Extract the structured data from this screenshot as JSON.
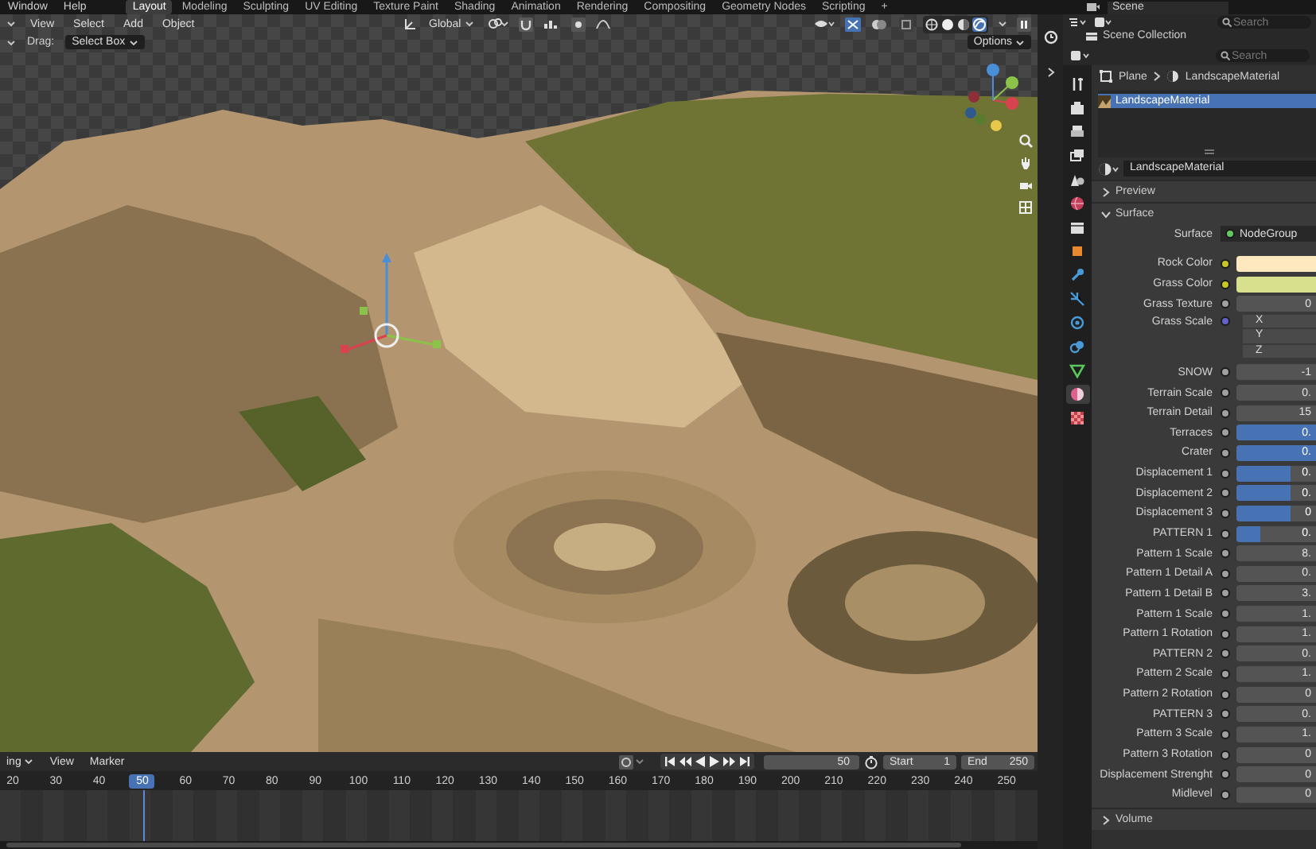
{
  "topbar": {
    "menus": [
      "Window",
      "Help"
    ],
    "workspaces": [
      {
        "label": "Layout",
        "selected": true
      },
      {
        "label": "Modeling",
        "selected": false
      },
      {
        "label": "Sculpting",
        "selected": false
      },
      {
        "label": "UV Editing",
        "selected": false
      },
      {
        "label": "Texture Paint",
        "selected": false
      },
      {
        "label": "Shading",
        "selected": false
      },
      {
        "label": "Animation",
        "selected": false
      },
      {
        "label": "Rendering",
        "selected": false
      },
      {
        "label": "Compositing",
        "selected": false
      },
      {
        "label": "Geometry Nodes",
        "selected": false
      },
      {
        "label": "Scripting",
        "selected": false
      }
    ],
    "add": "+",
    "scene": "Scene"
  },
  "viewport": {
    "menus": [
      "View",
      "Select",
      "Add",
      "Object"
    ],
    "orientation": "Global",
    "drag_label": "Drag:",
    "drag_tool": "Select Box",
    "options": "Options",
    "shading_modes": [
      {
        "kind": "wire",
        "selected": false
      },
      {
        "kind": "solid",
        "selected": false
      },
      {
        "kind": "material",
        "selected": false
      },
      {
        "kind": "rendered",
        "selected": true
      }
    ]
  },
  "outliner": {
    "search_placeholder": "Search",
    "root": "Scene Collection"
  },
  "properties": {
    "search_placeholder": "Search",
    "tabs": [
      {
        "kind": "tool",
        "selected": false
      },
      {
        "kind": "render",
        "selected": false
      },
      {
        "kind": "output",
        "selected": false
      },
      {
        "kind": "view_layer",
        "selected": false
      },
      {
        "kind": "scene",
        "selected": false
      },
      {
        "kind": "world",
        "selected": false
      },
      {
        "kind": "collection",
        "selected": false
      },
      {
        "kind": "object",
        "selected": false
      },
      {
        "kind": "modifier",
        "selected": false
      },
      {
        "kind": "particles",
        "selected": false
      },
      {
        "kind": "physics",
        "selected": false
      },
      {
        "kind": "constraints",
        "selected": false
      },
      {
        "kind": "data",
        "selected": false
      },
      {
        "kind": "material",
        "selected": true
      },
      {
        "kind": "texture",
        "selected": false
      }
    ],
    "breadcrumb": [
      "Plane",
      "LandscapeMaterial"
    ],
    "slots": [
      {
        "label": "LandscapeMaterial",
        "selected": true
      }
    ],
    "material": "LandscapeMaterial",
    "panels": [
      {
        "label": "Preview",
        "expanded": false
      },
      {
        "label": "Surface",
        "expanded": true
      }
    ],
    "surface": {
      "label": "Surface",
      "value": "NodeGroup"
    },
    "inputs": [
      {
        "label": "Rock Color",
        "kind": "color",
        "color": "#fde8bf"
      },
      {
        "label": "Grass Color",
        "kind": "color",
        "color": "#d8e08e"
      },
      {
        "label": "Grass Texture",
        "kind": "value",
        "value": "0"
      },
      {
        "label": "Grass Scale",
        "kind": "vector",
        "components": [
          "X",
          "Y",
          "Z"
        ]
      },
      {
        "label": "SNOW",
        "kind": "value",
        "value": "-1"
      },
      {
        "label": "Terrain Scale",
        "kind": "value",
        "value": "0."
      },
      {
        "label": "Terrain Detail",
        "kind": "value",
        "value": "15"
      },
      {
        "label": "Terraces",
        "kind": "slider",
        "value": "0.",
        "level": 1
      },
      {
        "label": "Crater",
        "kind": "slider",
        "value": "0.",
        "level": 1
      },
      {
        "label": "Displacement 1",
        "kind": "slider",
        "value": "0.",
        "level": 0.68
      },
      {
        "label": "Displacement 2",
        "kind": "slider",
        "value": "0.",
        "level": 0.68
      },
      {
        "label": "Displacement 3",
        "kind": "slider",
        "value": "0",
        "level": 0.68
      },
      {
        "label": "PATTERN 1",
        "kind": "slider",
        "value": "0.",
        "level": 0.3
      },
      {
        "label": "Pattern 1 Scale",
        "kind": "value",
        "value": "8."
      },
      {
        "label": "Pattern 1 Detail A",
        "kind": "value",
        "value": "0."
      },
      {
        "label": "Pattern 1 Detail B",
        "kind": "value",
        "value": "3."
      },
      {
        "label": "Pattern 1 Scale",
        "kind": "value",
        "value": "1."
      },
      {
        "label": "Pattern 1 Rotation",
        "kind": "value",
        "value": "1."
      },
      {
        "label": "PATTERN 2",
        "kind": "value",
        "value": "0."
      },
      {
        "label": "Pattern 2 Scale",
        "kind": "value",
        "value": "1."
      },
      {
        "label": "Pattern 2 Rotation",
        "kind": "value",
        "value": "0"
      },
      {
        "label": "PATTERN 3",
        "kind": "value",
        "value": "0."
      },
      {
        "label": "Pattern 3 Scale",
        "kind": "value",
        "value": "1."
      },
      {
        "label": "Pattern 3 Rotation",
        "kind": "value",
        "value": "0"
      },
      {
        "label": "Displacement Strenght",
        "kind": "value",
        "value": "0"
      },
      {
        "label": "Midlevel",
        "kind": "value",
        "value": "0"
      }
    ],
    "footer_panel": {
      "label": "Volume",
      "expanded": false
    }
  },
  "timeline": {
    "menus": [
      "ing",
      "View",
      "Marker"
    ],
    "current_frame": "50",
    "start_label": "Start",
    "start": "1",
    "end_label": "End",
    "end": "250",
    "ticks": [
      {
        "label": "20",
        "selected": false
      },
      {
        "label": "30",
        "selected": false
      },
      {
        "label": "40",
        "selected": false
      },
      {
        "label": "50",
        "selected": true
      },
      {
        "label": "60",
        "selected": false
      },
      {
        "label": "70",
        "selected": false
      },
      {
        "label": "80",
        "selected": false
      },
      {
        "label": "90",
        "selected": false
      },
      {
        "label": "100",
        "selected": false
      },
      {
        "label": "110",
        "selected": false
      },
      {
        "label": "120",
        "selected": false
      },
      {
        "label": "130",
        "selected": false
      },
      {
        "label": "140",
        "selected": false
      },
      {
        "label": "150",
        "selected": false
      },
      {
        "label": "160",
        "selected": false
      },
      {
        "label": "170",
        "selected": false
      },
      {
        "label": "180",
        "selected": false
      },
      {
        "label": "190",
        "selected": false
      },
      {
        "label": "200",
        "selected": false
      },
      {
        "label": "210",
        "selected": false
      },
      {
        "label": "220",
        "selected": false
      },
      {
        "label": "230",
        "selected": false
      },
      {
        "label": "240",
        "selected": false
      },
      {
        "label": "250",
        "selected": false
      }
    ]
  }
}
